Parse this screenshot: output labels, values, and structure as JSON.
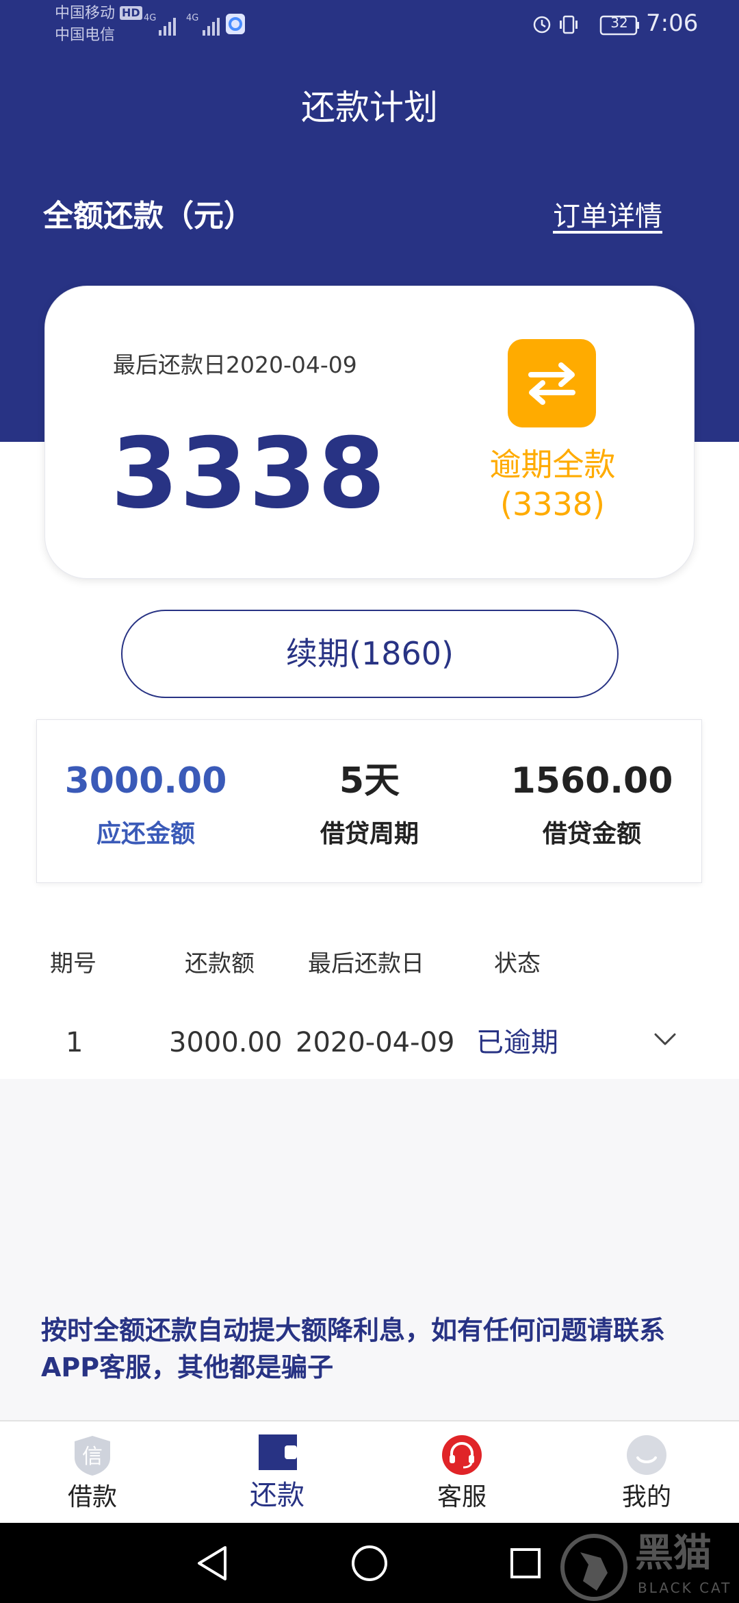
{
  "status_bar": {
    "carrier1": "中国移动",
    "carrier1_badge": "HD",
    "carrier2": "中国电信",
    "network1": "4G",
    "network2": "4G",
    "battery": "32",
    "time": "7:06"
  },
  "header": {
    "title": "还款计划",
    "subtitle": "全额还款（元）",
    "order_link": "订单详情"
  },
  "card": {
    "due_date_label": "最后还款日2020-04-09",
    "amount": "3338",
    "overdue_line1": "逾期全款",
    "overdue_line2": "(3338)",
    "swap_icon": "swap-arrows-icon"
  },
  "renew_button": "续期(1860)",
  "stats": [
    {
      "value": "3000.00",
      "label": "应还金额",
      "color": "#3a5ab8"
    },
    {
      "value": "5天",
      "label": "借贷周期",
      "color": "#222222"
    },
    {
      "value": "1560.00",
      "label": "借贷金额",
      "color": "#222222"
    }
  ],
  "table": {
    "headers": [
      "期号",
      "还款额",
      "最后还款日",
      "状态"
    ],
    "rows": [
      {
        "period": "1",
        "amount": "3000.00",
        "due": "2020-04-09",
        "status": "已逾期"
      }
    ]
  },
  "notice": "按时全额还款自动提大额降利息，如有任何问题请联系APP客服，其他都是骗子",
  "tabs": [
    {
      "label": "借款",
      "icon": "shield-loan-icon",
      "icon_text": "信"
    },
    {
      "label": "还款",
      "icon": "repay-card-icon",
      "active": true
    },
    {
      "label": "客服",
      "icon": "headset-icon"
    },
    {
      "label": "我的",
      "icon": "smiley-profile-icon"
    }
  ],
  "colors": {
    "navy": "#283384",
    "orange": "#ffab00",
    "blue_text": "#3a5ab8",
    "status_overdue": "#283384"
  },
  "watermark": {
    "text_cn": "黑猫",
    "text_en": "BLACK CAT"
  }
}
